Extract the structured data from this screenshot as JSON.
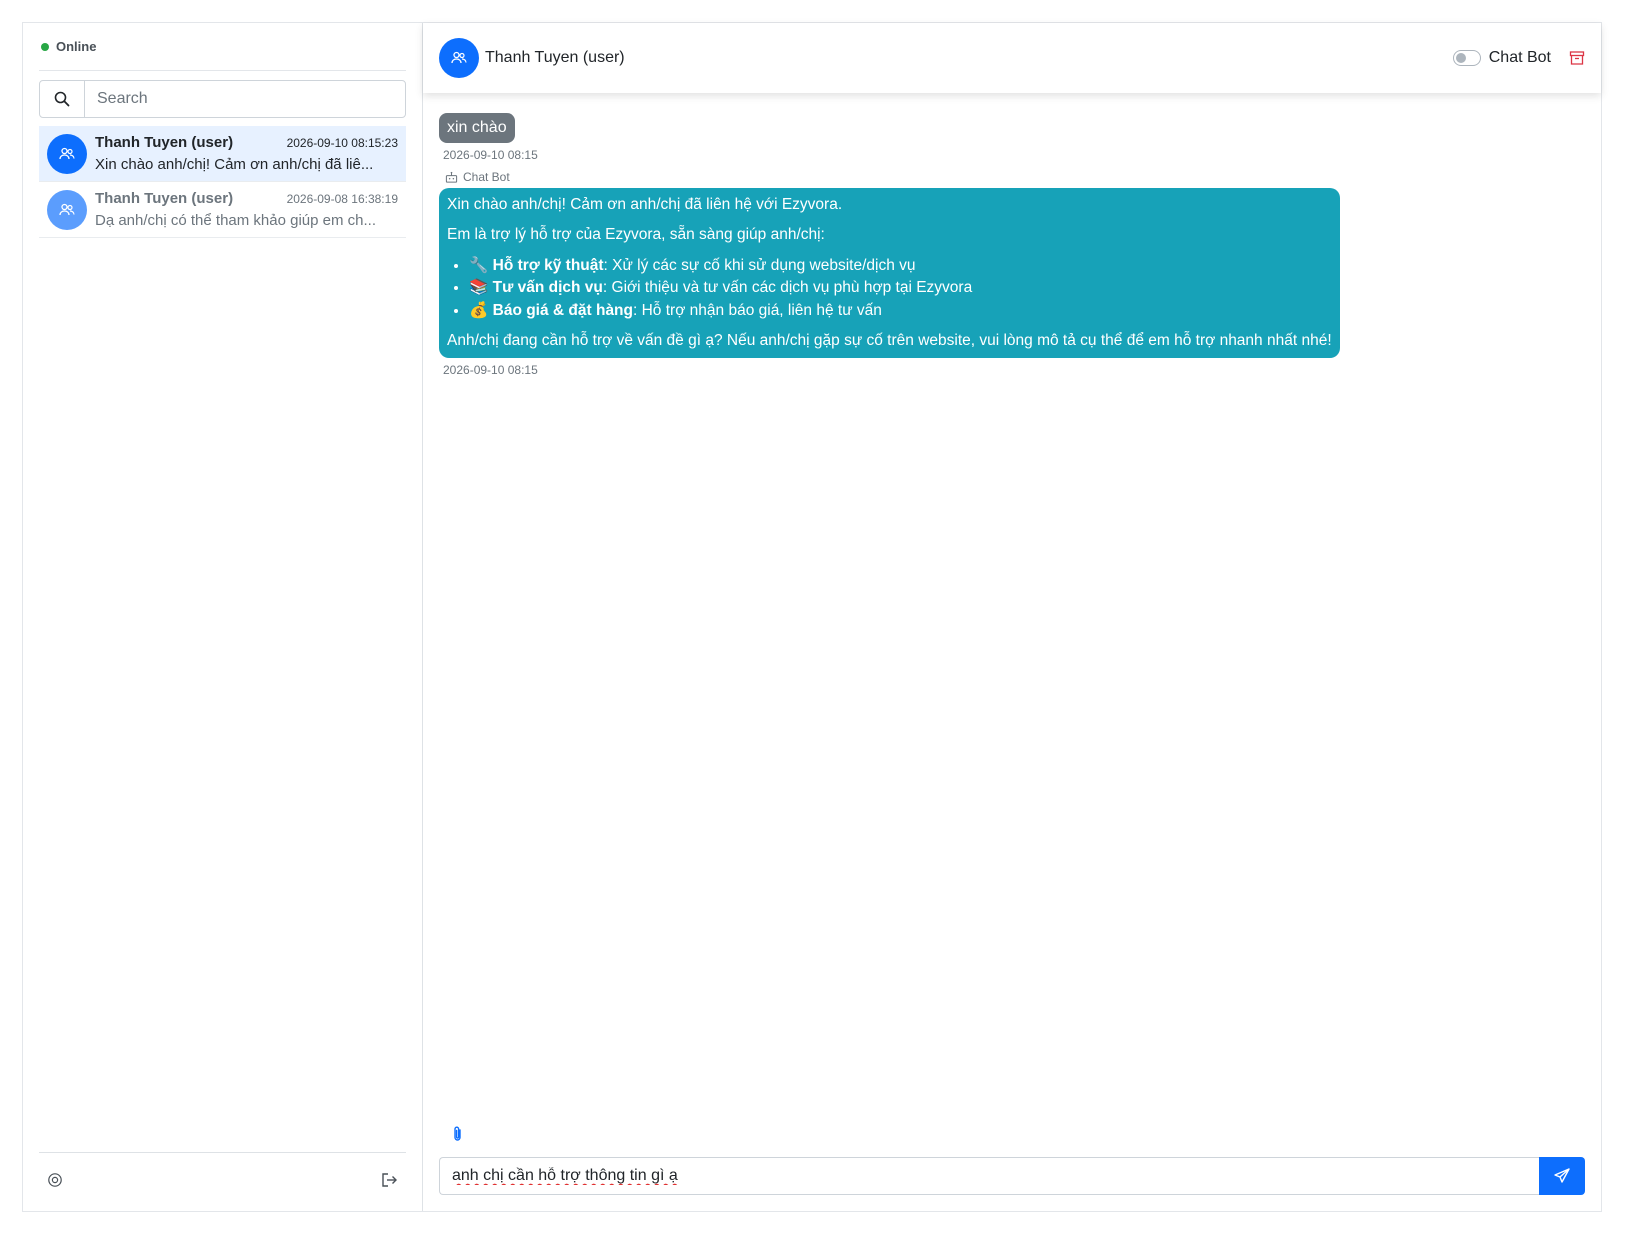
{
  "sidebar": {
    "status": "Online",
    "search_placeholder": "Search",
    "conversations": [
      {
        "name": "Thanh Tuyen (user)",
        "time": "2026-09-10 08:15:23",
        "preview": "Xin chào anh/chị! Cảm ơn anh/chị đã liê..."
      },
      {
        "name": "Thanh Tuyen (user)",
        "time": "2026-09-08 16:38:19",
        "preview": "Dạ anh/chị có thể tham khảo giúp em ch..."
      }
    ]
  },
  "header": {
    "title": "Thanh Tuyen (user)",
    "toggle_label": "Chat Bot"
  },
  "messages": {
    "user_text": "xin chào",
    "user_time": "2026-09-10 08:15",
    "bot_label": "Chat Bot",
    "bot_intro": "Xin chào anh/chị! Cảm ơn anh/chị đã liên hệ với Ezyvora.",
    "bot_line2": "Em là trợ lý hỗ trợ của Ezyvora, sẵn sàng giúp anh/chị:",
    "bot_items": [
      {
        "emoji": "🔧",
        "title": "Hỗ trợ kỹ thuật",
        "text": ": Xử lý các sự cố khi sử dụng website/dịch vụ"
      },
      {
        "emoji": "📚",
        "title": "Tư vấn dịch vụ",
        "text": ": Giới thiệu và tư vấn các dịch vụ phù hợp tại Ezyvora"
      },
      {
        "emoji": "💰",
        "title": "Báo giá & đặt hàng",
        "text": ": Hỗ trợ nhận báo giá, liên hệ tư vấn"
      }
    ],
    "bot_outro": "Anh/chị đang cần hỗ trợ về vấn đề gì ạ? Nếu anh/chị gặp sự cố trên website, vui lòng mô tả cụ thể để em hỗ trợ nhanh nhất nhé!",
    "bot_time": "2026-09-10 08:15"
  },
  "composer": {
    "value": "anh chị cần hỗ trợ thông tin gì ạ"
  },
  "colors": {
    "primary": "#0d6efd",
    "bot_bubble": "#17a2b8",
    "user_bubble": "#6c757d",
    "online": "#28a745",
    "archive": "#dc3545"
  }
}
